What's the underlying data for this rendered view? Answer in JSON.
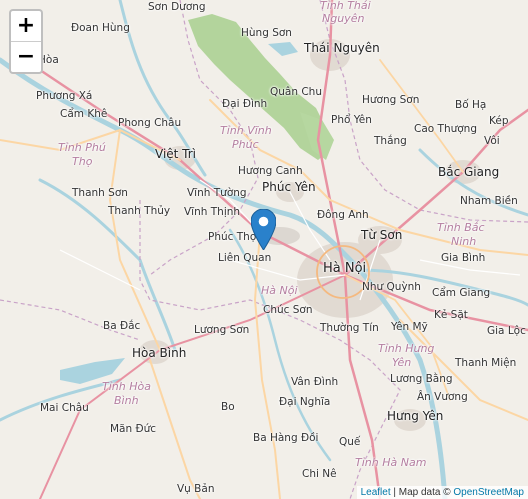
{
  "zoom": {
    "in_label": "+",
    "out_label": "−"
  },
  "attribution": {
    "leaflet": "Leaflet",
    "separator": " | Map data © ",
    "osm": "OpenStreetMap"
  },
  "labels": {
    "son_duong": "Sơn Dương",
    "tinh_thai_nguyen": "Tỉnh Thái Nguyên",
    "doan_hung": "Đoan Hùng",
    "hung_son_top": "Hùng Sơn",
    "thai_nguyen": "Thái Nguyên",
    "hoa": "Hòa",
    "quan_chu": "Quân Chu",
    "phuong_xa": "Phương Xá",
    "dai_dinh": "Đại Đình",
    "huong_son": "Hương Sơn",
    "bo_ha": "Bố Hạ",
    "cam_khe": "Cẩm Khê",
    "phong_chau": "Phong Châu",
    "tinh_vinh_phuc": "Tỉnh Vĩnh Phúc",
    "pho_yen": "Phổ Yên",
    "cao_thuong": "Cao Thượng",
    "kep": "Kép",
    "tinh_phu_tho": "Tỉnh Phú Thọ",
    "viet_tri": "Việt Trì",
    "thang": "Thắng",
    "voi": "Vôi",
    "huong_canh": "Hương Canh",
    "phuc_yen": "Phúc Yên",
    "bac_giang": "Bắc Giang",
    "thanh_son": "Thanh Sơn",
    "vinh_tuong": "Vĩnh Tường",
    "thanh_thuy": "Thanh Thủy",
    "vinh_thinh": "Vĩnh Thịnh",
    "dong_anh": "Đông Anh",
    "nham_bien": "Nham Biền",
    "phuc_tho": "Phúc Thọ",
    "tu_son": "Từ Sơn",
    "tinh_bac_ninh": "Tỉnh Bắc Ninh",
    "lien_quan": "Liên Quan",
    "ha_noi": "Hà Nội",
    "gia_binh": "Gia Bình",
    "ha_noi_prov": "Hà Nội",
    "nhu_quynh": "Như Quỳnh",
    "cam_giang": "Cẩm Giang",
    "chuc_son": "Chúc Sơn",
    "ba_dac": "Ba Đắc",
    "ke_sat": "Kẻ Sặt",
    "luong_son": "Lương Sơn",
    "thuong_tin": "Thường Tín",
    "yen_my": "Yên Mỹ",
    "gia_loc": "Gia Lộc",
    "hoa_binh": "Hòa Bình",
    "tinh_hung_yen": "Tỉnh Hưng Yên",
    "thanh_mien": "Thanh Miện",
    "van_dinh": "Vân Đình",
    "luong_bang": "Lương Bằng",
    "tinh_hoa_binh": "Tỉnh Hòa Bình",
    "dai_nghia": "Đại Nghĩa",
    "an_vuong": "Ân Vương",
    "mai_chau": "Mai Châu",
    "bo": "Bo",
    "hung_yen": "Hưng Yên",
    "man_duc": "Mãn Đức",
    "ba_hang_doi": "Ba Hàng Đồi",
    "que": "Quế",
    "tinh_ha_nam": "Tỉnh Hà Nam",
    "chi_ne": "Chi Nê",
    "vu_ban": "Vụ Bản"
  },
  "marker": {
    "icon": "map-pin-icon",
    "color": "#2a81cb"
  }
}
